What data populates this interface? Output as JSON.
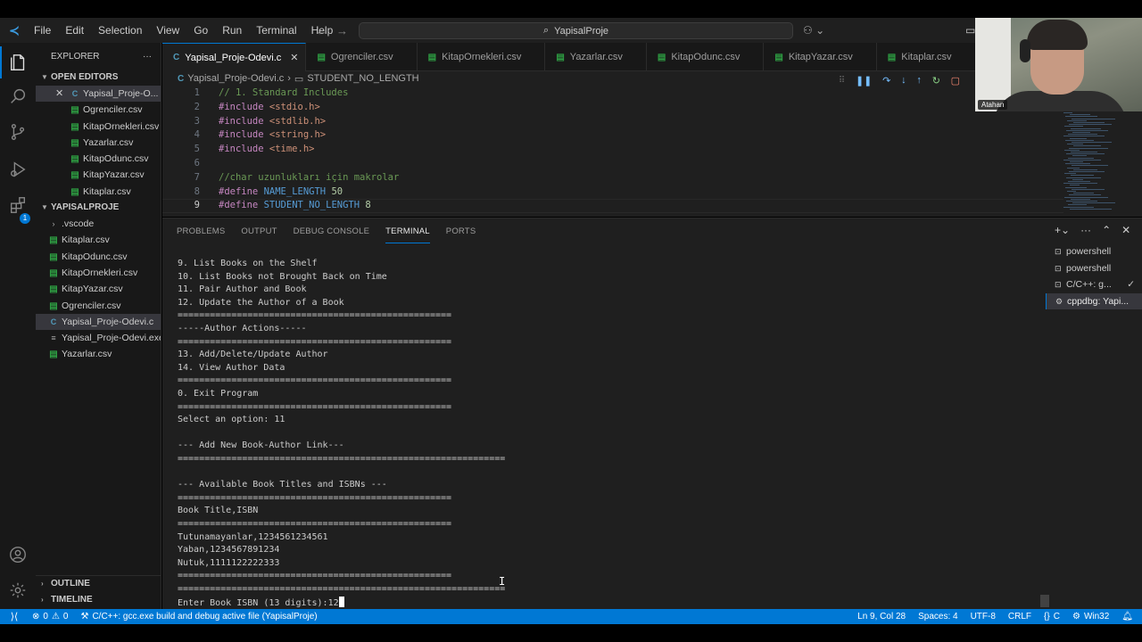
{
  "menu": [
    "File",
    "Edit",
    "Selection",
    "View",
    "Go",
    "Run",
    "Terminal",
    "Help"
  ],
  "search": {
    "text": "YapisalProje"
  },
  "explorer": {
    "title": "EXPLORER",
    "open_editors_title": "OPEN EDITORS",
    "open_editors": [
      {
        "name": "Yapisal_Proje-O...",
        "type": "c",
        "selected": true
      },
      {
        "name": "Ogrenciler.csv",
        "type": "csv"
      },
      {
        "name": "KitapOrnekleri.csv",
        "type": "csv"
      },
      {
        "name": "Yazarlar.csv",
        "type": "csv"
      },
      {
        "name": "KitapOdunc.csv",
        "type": "csv"
      },
      {
        "name": "KitapYazar.csv",
        "type": "csv"
      },
      {
        "name": "Kitaplar.csv",
        "type": "csv"
      }
    ],
    "project_title": "YAPISALPROJE",
    "project_files": [
      {
        "name": ".vscode",
        "type": "folder"
      },
      {
        "name": "Kitaplar.csv",
        "type": "csv"
      },
      {
        "name": "KitapOdunc.csv",
        "type": "csv"
      },
      {
        "name": "KitapOrnekleri.csv",
        "type": "csv"
      },
      {
        "name": "KitapYazar.csv",
        "type": "csv"
      },
      {
        "name": "Ogrenciler.csv",
        "type": "csv"
      },
      {
        "name": "Yapisal_Proje-Odevi.c",
        "type": "c",
        "selected": true
      },
      {
        "name": "Yapisal_Proje-Odevi.exe",
        "type": "exe"
      },
      {
        "name": "Yazarlar.csv",
        "type": "csv"
      }
    ],
    "outline": "OUTLINE",
    "timeline": "TIMELINE"
  },
  "tabs": [
    {
      "label": "Yapisal_Proje-Odevi.c",
      "type": "c",
      "active": true
    },
    {
      "label": "Ogrenciler.csv",
      "type": "csv"
    },
    {
      "label": "KitapOrnekleri.csv",
      "type": "csv"
    },
    {
      "label": "Yazarlar.csv",
      "type": "csv"
    },
    {
      "label": "KitapOdunc.csv",
      "type": "csv"
    },
    {
      "label": "KitapYazar.csv",
      "type": "csv"
    },
    {
      "label": "Kitaplar.csv",
      "type": "csv"
    }
  ],
  "breadcrumb": {
    "file": "Yapisal_Proje-Odevi.c",
    "symbol": "STUDENT_NO_LENGTH"
  },
  "code": [
    {
      "n": "1",
      "text": "// 1. Standard Includes",
      "kind": "comment"
    },
    {
      "n": "2",
      "kw": "#include",
      "rest": " <stdio.h>"
    },
    {
      "n": "3",
      "kw": "#include",
      "rest": " <stdlib.h>"
    },
    {
      "n": "4",
      "kw": "#include",
      "rest": " <string.h>"
    },
    {
      "n": "5",
      "kw": "#include",
      "rest": " <time.h>"
    },
    {
      "n": "6",
      "text": ""
    },
    {
      "n": "7",
      "text": "//char uzunlukları için makrolar",
      "kind": "comment"
    },
    {
      "n": "8",
      "kw": "#define",
      "macro": " NAME_LENGTH",
      "num": " 50"
    },
    {
      "n": "9",
      "kw": "#define",
      "macro": " STUDENT_NO_LENGTH",
      "num": " 8"
    }
  ],
  "panel": {
    "tabs": [
      "PROBLEMS",
      "OUTPUT",
      "DEBUG CONSOLE",
      "TERMINAL",
      "PORTS"
    ],
    "active_tab": "TERMINAL"
  },
  "terminal_lines": [
    "9. List Books on the Shelf",
    "10. List Books not Brought Back on Time",
    "11. Pair Author and Book",
    "12. Update the Author of a Book",
    "===================================================",
    "-----Author Actions-----",
    "===================================================",
    "13. Add/Delete/Update Author",
    "14. View Author Data",
    "===================================================",
    "0. Exit Program",
    "===================================================",
    "Select an option: 11",
    "",
    "--- Add New Book-Author Link---",
    "=============================================================",
    "",
    "--- Available Book Titles and ISBNs ---",
    "===================================================",
    "Book Title,ISBN",
    "===================================================",
    "Tutunamayanlar,1234561234561",
    "Yaban,1234567891234",
    "Nutuk,1111122222333",
    "===================================================",
    "=============================================================",
    "Enter Book ISBN (13 digits):12"
  ],
  "terminal_instances": [
    {
      "label": "powershell",
      "icon": ">"
    },
    {
      "label": "powershell",
      "icon": ">"
    },
    {
      "label": "C/C++: g...",
      "icon": ">",
      "check": true
    },
    {
      "label": "cppdbg: Yapi...",
      "icon": "gear",
      "active": true
    }
  ],
  "status": {
    "errors": "0",
    "warnings": "0",
    "task": "C/C++: gcc.exe build and debug active file (YapisalProje)",
    "position": "Ln 9, Col 28",
    "spaces": "Spaces: 4",
    "encoding": "UTF-8",
    "eol": "CRLF",
    "language": "C",
    "platform": "Win32"
  },
  "webcam": {
    "name": "Atahan"
  },
  "colors": {
    "accent": "#0078d4",
    "statusbar": "#0078d4",
    "editor_bg": "#1f1f1f",
    "sidebar_bg": "#181818"
  }
}
